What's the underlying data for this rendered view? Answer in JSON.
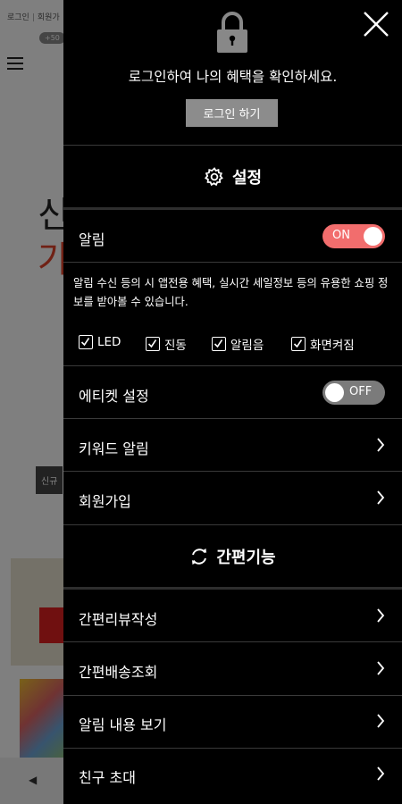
{
  "background": {
    "top_links": [
      "로그인",
      "회원가"
    ],
    "badge": "+50",
    "big_text_1": "신",
    "big_text_2": "가",
    "pill": "신규"
  },
  "drawer": {
    "login_message": "로그인하여 나의 혜택을 확인하세요.",
    "login_button": "로그인 하기",
    "settings_title": "설정",
    "notification": {
      "label": "알림",
      "toggle": "ON",
      "description": "알림 수신 등의 시 앱전용 혜택, 실시간 세일정보 등의 유용한 쇼핑 정보를 받아볼 수 있습니다.",
      "options": [
        "LED",
        "진동",
        "알림음",
        "화면켜짐"
      ]
    },
    "etiquette": {
      "label": "에티켓 설정",
      "toggle": "OFF"
    },
    "keyword_alarm": "키워드 알림",
    "signup": "회원가입",
    "quick_title": "간편기능",
    "quick_items": [
      "간편리뷰작성",
      "간편배송조회",
      "알림 내용 보기",
      "친구 초대"
    ]
  },
  "colors": {
    "drawer_bg": "#000000",
    "toggle_on": "#f26d6d",
    "toggle_off": "#7b7b7b",
    "login_button_bg": "#8c8c8c"
  },
  "icons": [
    "lock-icon",
    "close-icon",
    "gear-icon",
    "refresh-icon",
    "chevron-right-icon",
    "checkbox-checked-icon"
  ]
}
